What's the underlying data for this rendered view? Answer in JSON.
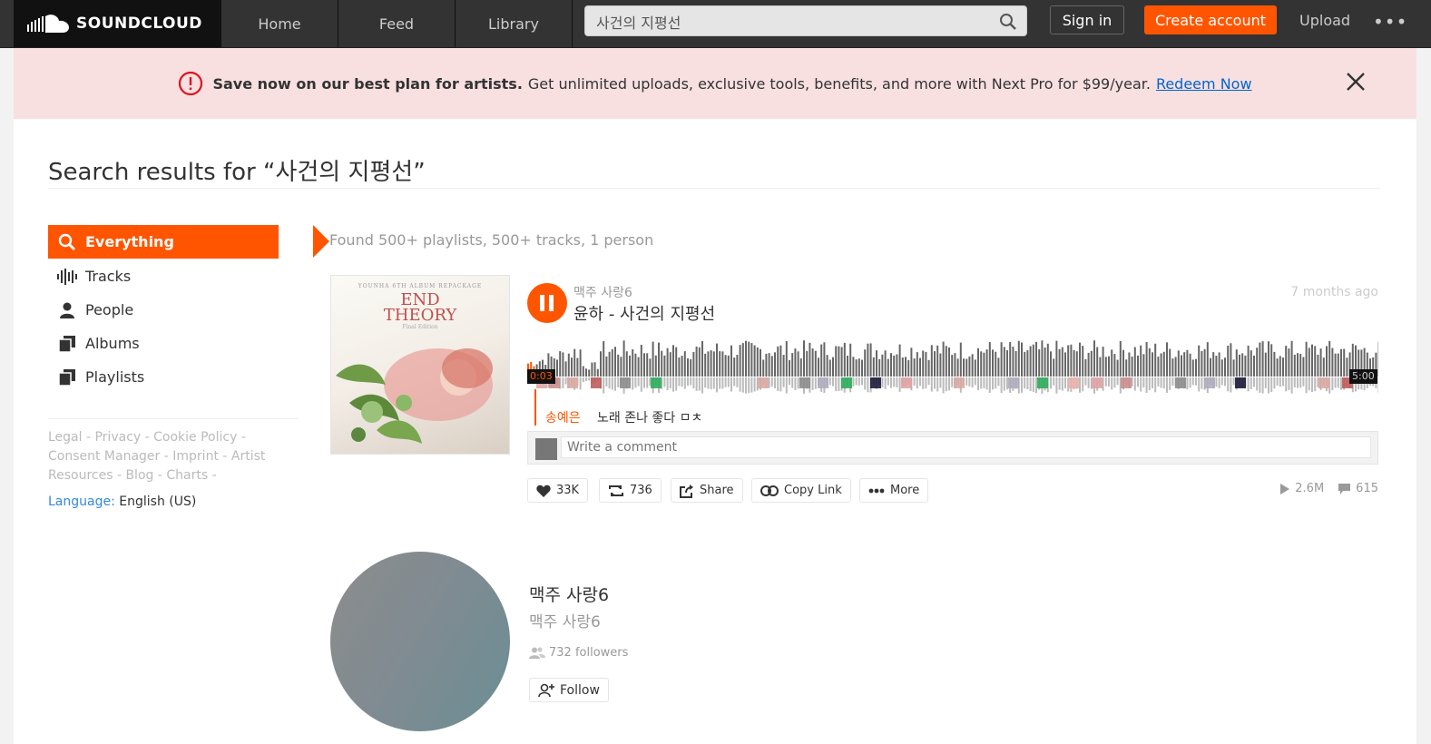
{
  "header": {
    "brand": "SOUNDCLOUD",
    "nav": [
      {
        "label": "Home"
      },
      {
        "label": "Feed"
      },
      {
        "label": "Library"
      }
    ],
    "search_value": "사건의 지평선",
    "signin": "Sign in",
    "create_account": "Create account",
    "upload": "Upload",
    "more": "•••"
  },
  "banner": {
    "strong": "Save now on our best plan for artists.",
    "text": "Get unlimited uploads, exclusive tools, benefits, and more with Next Pro for $99/year.",
    "link": "Redeem Now"
  },
  "page": {
    "title": "Search results for “사건의 지평선”"
  },
  "sidebar": {
    "items": [
      {
        "label": "Everything",
        "icon": "search-icon",
        "active": true
      },
      {
        "label": "Tracks",
        "icon": "waveform-icon"
      },
      {
        "label": "People",
        "icon": "person-icon"
      },
      {
        "label": "Albums",
        "icon": "album-icon"
      },
      {
        "label": "Playlists",
        "icon": "playlist-icon"
      }
    ],
    "footer": {
      "legal": "Legal",
      "privacy": "Privacy",
      "cookie": "Cookie Policy",
      "consent": "Consent Manager",
      "imprint": "Imprint",
      "artist": "Artist Resources",
      "blog": "Blog",
      "charts": "Charts",
      "sep": " - ",
      "language_label": "Language:",
      "language_value": "English (US)"
    }
  },
  "results": {
    "found": "Found 500+ playlists, 500+ tracks, 1 person",
    "track": {
      "artwork_top": "YOUNHA 6TH ALBUM REPACKAGE",
      "artwork_title_1": "END",
      "artwork_title_2": "THEORY",
      "artwork_sub": "Final Edition",
      "uploader": "맥주 사랑6",
      "title": "윤하 - 사건의 지평선",
      "time_ago": "7 months ago",
      "time_start": "0:03",
      "time_end": "5:00",
      "progress": 0.01,
      "comment_user": "송예은",
      "comment_text": "노래 존나 좋다 ㅁㅊ",
      "comment_placeholder": "Write a comment",
      "likes": "33K",
      "reposts": "736",
      "share": "Share",
      "copy_link": "Copy Link",
      "more": "More",
      "plays": "2.6M",
      "comments": "615"
    },
    "user": {
      "name": "맥주 사랑6",
      "handle": "맥주 사랑6",
      "followers": "732 followers",
      "follow": "Follow"
    }
  },
  "colors": {
    "accent": "#ff5500",
    "header_bg": "#333333",
    "banner_bg": "#f8e0e1",
    "link": "#0066cc"
  }
}
